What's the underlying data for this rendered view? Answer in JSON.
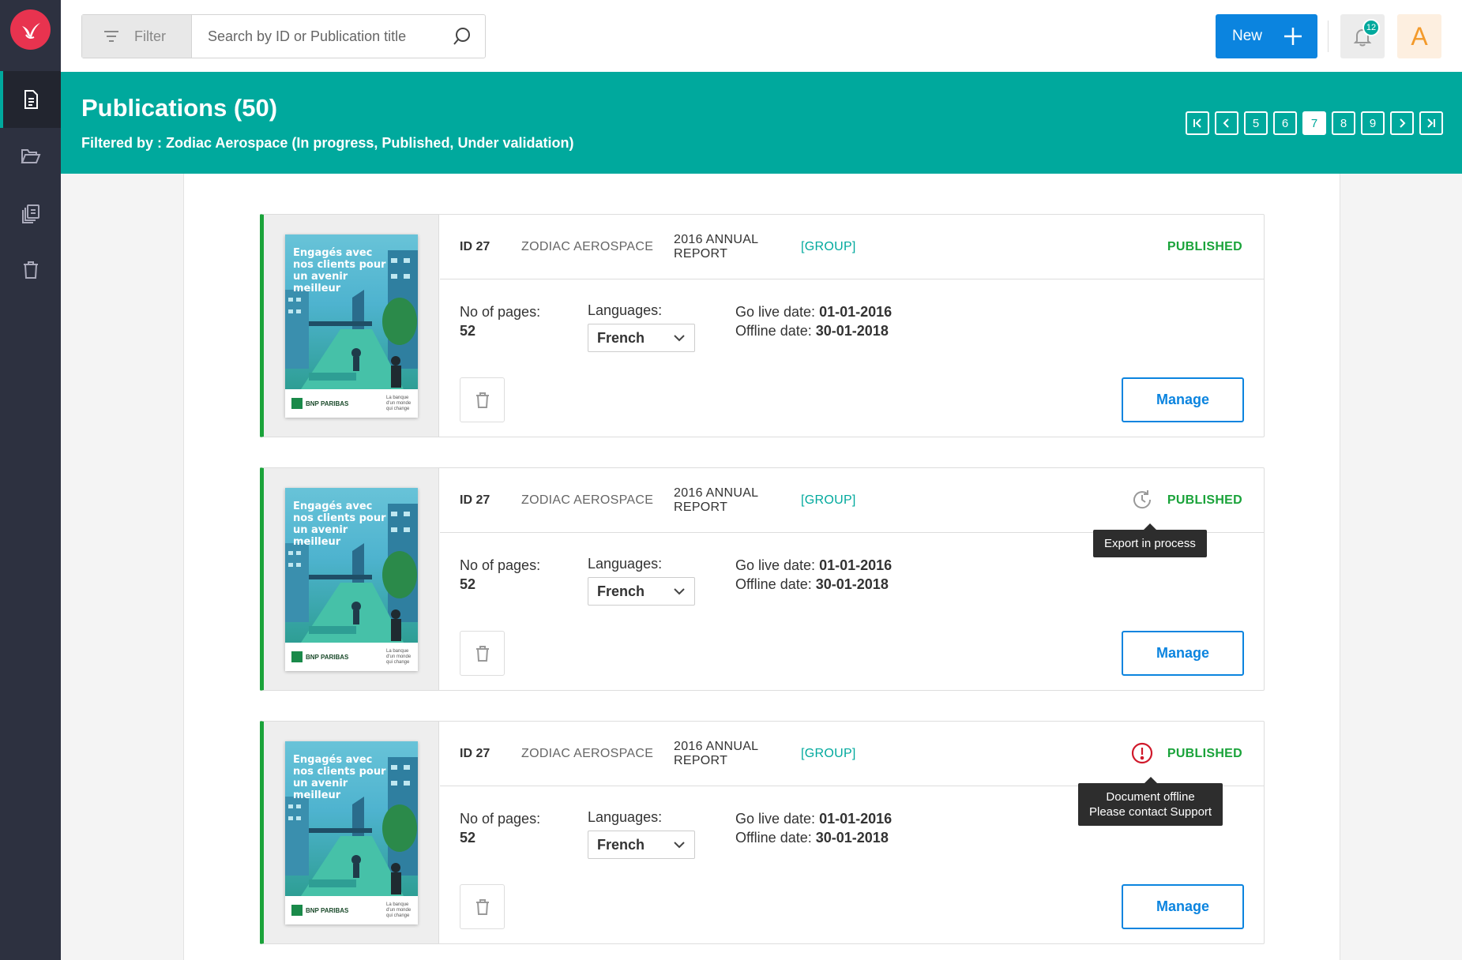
{
  "app": {
    "logo": "bird-logo"
  },
  "sidebar": {
    "items": [
      {
        "name": "publications",
        "icon": "document-icon",
        "active": true
      },
      {
        "name": "folders",
        "icon": "folder-open-icon",
        "active": false
      },
      {
        "name": "library",
        "icon": "stack-icon",
        "active": false
      },
      {
        "name": "trash",
        "icon": "trash-icon",
        "active": false
      }
    ]
  },
  "topbar": {
    "filter_label": "Filter",
    "search_placeholder": "Search by ID or Publication title",
    "new_label": "New",
    "notifications_count": "12",
    "avatar_letter": "A"
  },
  "header": {
    "title": "Publications (50)",
    "filter_text": "Filtered by : Zodiac Aerospace (In progress, Published, Under validation)"
  },
  "pagination": {
    "pages": [
      "5",
      "6",
      "7",
      "8",
      "9"
    ],
    "current": "7"
  },
  "colors": {
    "brand": "#e8334f",
    "teal": "#00a99d",
    "primary": "#0b84df",
    "published": "#1aa33a",
    "error": "#d0192b"
  },
  "publications": [
    {
      "cover_title": "Engagés avec nos clients pour un avenir meilleur",
      "cover_brand": "BNP PARIBAS",
      "cover_tagline": "La banque d'un monde qui change",
      "id": "ID 27",
      "company": "ZODIAC AEROSPACE",
      "report": "2016 ANNUAL REPORT",
      "group": "[GROUP]",
      "status": "PUBLISHED",
      "pages_label": "No of pages:",
      "pages": "52",
      "languages_label": "Languages:",
      "language": "French",
      "go_live_label": "Go live date:",
      "go_live": "01-01-2016",
      "offline_label": "Offline date:",
      "offline": "30-01-2018",
      "manage_label": "Manage"
    },
    {
      "cover_title": "Engagés avec nos clients pour un avenir meilleur",
      "cover_brand": "BNP PARIBAS",
      "cover_tagline": "La banque d'un monde qui change",
      "id": "ID 27",
      "company": "ZODIAC AEROSPACE",
      "report": "2016 ANNUAL REPORT",
      "group": "[GROUP]",
      "status": "PUBLISHED",
      "status_icon": "clock-refresh-icon",
      "tooltip": "Export in process",
      "pages_label": "No of pages:",
      "pages": "52",
      "languages_label": "Languages:",
      "language": "French",
      "go_live_label": "Go live date:",
      "go_live": "01-01-2016",
      "offline_label": "Offline date:",
      "offline": "30-01-2018",
      "manage_label": "Manage"
    },
    {
      "cover_title": "Engagés avec nos clients pour un avenir meilleur",
      "cover_brand": "BNP PARIBAS",
      "cover_tagline": "La banque d'un monde qui change",
      "id": "ID 27",
      "company": "ZODIAC AEROSPACE",
      "report": "2016 ANNUAL REPORT",
      "group": "[GROUP]",
      "status": "PUBLISHED",
      "status_icon": "alert-circle-icon",
      "tooltip_line1": "Document offline",
      "tooltip_line2": "Please contact Support",
      "pages_label": "No of pages:",
      "pages": "52",
      "languages_label": "Languages:",
      "language": "French",
      "go_live_label": "Go live date:",
      "go_live": "01-01-2016",
      "offline_label": "Offline date:",
      "offline": "30-01-2018",
      "manage_label": "Manage"
    }
  ]
}
